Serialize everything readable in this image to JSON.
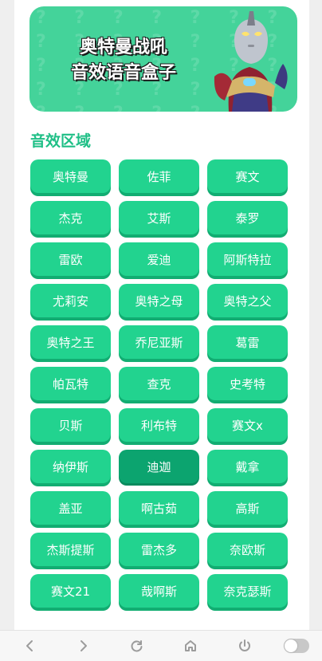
{
  "banner": {
    "title_line1": "奥特曼战吼",
    "title_line2": "音效语音盒子"
  },
  "section": {
    "title": "音效区域"
  },
  "buttons": [
    "奥特曼",
    "佐菲",
    "赛文",
    "杰克",
    "艾斯",
    "泰罗",
    "雷欧",
    "爱迪",
    "阿斯特拉",
    "尤莉安",
    "奥特之母",
    "奥特之父",
    "奥特之王",
    "乔尼亚斯",
    "葛雷",
    "帕瓦特",
    "查克",
    "史考特",
    "贝斯",
    "利布特",
    "赛文x",
    "纳伊斯",
    "迪迦",
    "戴拿",
    "盖亚",
    "啊古茹",
    "高斯",
    "杰斯提斯",
    "雷杰多",
    "奈欧斯",
    "赛文21",
    "哉啊斯",
    "奈克瑟斯"
  ],
  "active_button": "迪迦",
  "colors": {
    "accent": "#22d38f",
    "accent_shadow": "#12ad72",
    "active": "#0ca46f",
    "banner": "#44d39a",
    "section_title": "#1fbf86"
  },
  "browser_bar": {
    "icons": [
      "back-icon",
      "forward-icon",
      "refresh-icon",
      "home-icon",
      "power-icon",
      "toggle-switch"
    ]
  }
}
